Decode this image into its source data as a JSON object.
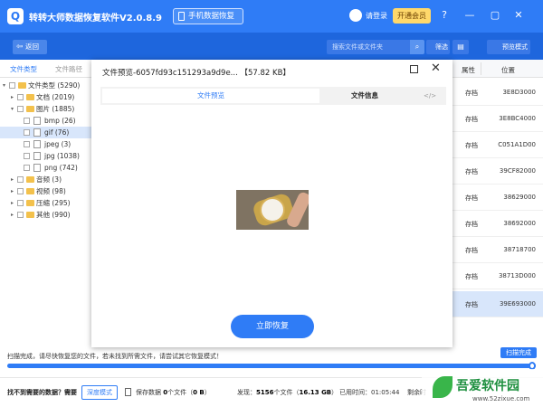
{
  "app": {
    "title": "转转大师数据恢复软件V2.0.8.9",
    "phone_recovery": "手机数据恢复",
    "login": "请登录",
    "vip": "开通会员",
    "window_buttons": [
      "?",
      "—",
      "▢",
      "✕"
    ]
  },
  "toolbar": {
    "back": "返回",
    "search_placeholder": "搜索文件或文件夹",
    "filter": "筛选",
    "preview_mode": "预览模式"
  },
  "sidebar": {
    "tabs": [
      "文件类型",
      "文件路径"
    ],
    "tree": [
      {
        "label": "文件类型 (5290)",
        "level": 0,
        "type": "folder",
        "expanded": true
      },
      {
        "label": "文档 (2019)",
        "level": 1,
        "type": "folder",
        "expanded": false
      },
      {
        "label": "图片 (1885)",
        "level": 1,
        "type": "folder",
        "expanded": true
      },
      {
        "label": "bmp (26)",
        "level": 2,
        "type": "file"
      },
      {
        "label": "gif (76)",
        "level": 2,
        "type": "file",
        "selected": true
      },
      {
        "label": "jpeg (3)",
        "level": 2,
        "type": "file"
      },
      {
        "label": "jpg (1038)",
        "level": 2,
        "type": "file"
      },
      {
        "label": "png (742)",
        "level": 2,
        "type": "file"
      },
      {
        "label": "音频 (3)",
        "level": 1,
        "type": "folder",
        "expanded": false
      },
      {
        "label": "视频 (98)",
        "level": 1,
        "type": "folder",
        "expanded": false
      },
      {
        "label": "压缩 (295)",
        "level": 1,
        "type": "folder",
        "expanded": false
      },
      {
        "label": "其他 (990)",
        "level": 1,
        "type": "folder",
        "expanded": false
      }
    ]
  },
  "list": {
    "headers": [
      "属性",
      "位置"
    ],
    "rows": [
      {
        "attr": "存档",
        "pos": "3E8D3000"
      },
      {
        "attr": "存档",
        "pos": "3E8BC4000"
      },
      {
        "attr": "存档",
        "pos": "C051A1D00"
      },
      {
        "attr": "存档",
        "pos": "39CF82000"
      },
      {
        "attr": "存档",
        "pos": "38629000"
      },
      {
        "attr": "存档",
        "pos": "38692000"
      },
      {
        "attr": "存档",
        "pos": "38718700"
      },
      {
        "attr": "存档",
        "pos": "38713D000"
      },
      {
        "attr": "存档",
        "pos": "39E693000",
        "selected": true
      }
    ]
  },
  "modal": {
    "title": "文件预览-6057fd93c151293a9d9e...",
    "size": "【57.82 KB】",
    "tabs": [
      "文件预览",
      "文件信息",
      "</>"
    ],
    "recover_button": "立即恢复"
  },
  "scan": {
    "status": "扫描完成，请尽快恢复您的文件，若未找到所需文件，请尝试其它恢复模式！",
    "badge": "扫描完成",
    "progress": 1.0
  },
  "bottom": {
    "question": "找不到需要的数据？需要",
    "deep_scan": "深度模式",
    "saved_label": "保存数据",
    "saved_files": "0",
    "saved_unit": "个文件（",
    "saved_size": "0 B",
    "saved_close": "）",
    "found_label": "发现：",
    "found_files": "5156",
    "found_unit": "个文件（",
    "found_size": "16.13 GB",
    "found_close": "）",
    "elapsed_label": "已用时间：",
    "elapsed": "01:05:44",
    "remain_label": "剩余时"
  },
  "watermark": {
    "title": "吾爱软件园",
    "url": "www.52zixue.com"
  },
  "colors": {
    "accent": "#2f7cf6",
    "toolbar": "#1e66dd",
    "selected_row": "#d8e6fb"
  }
}
